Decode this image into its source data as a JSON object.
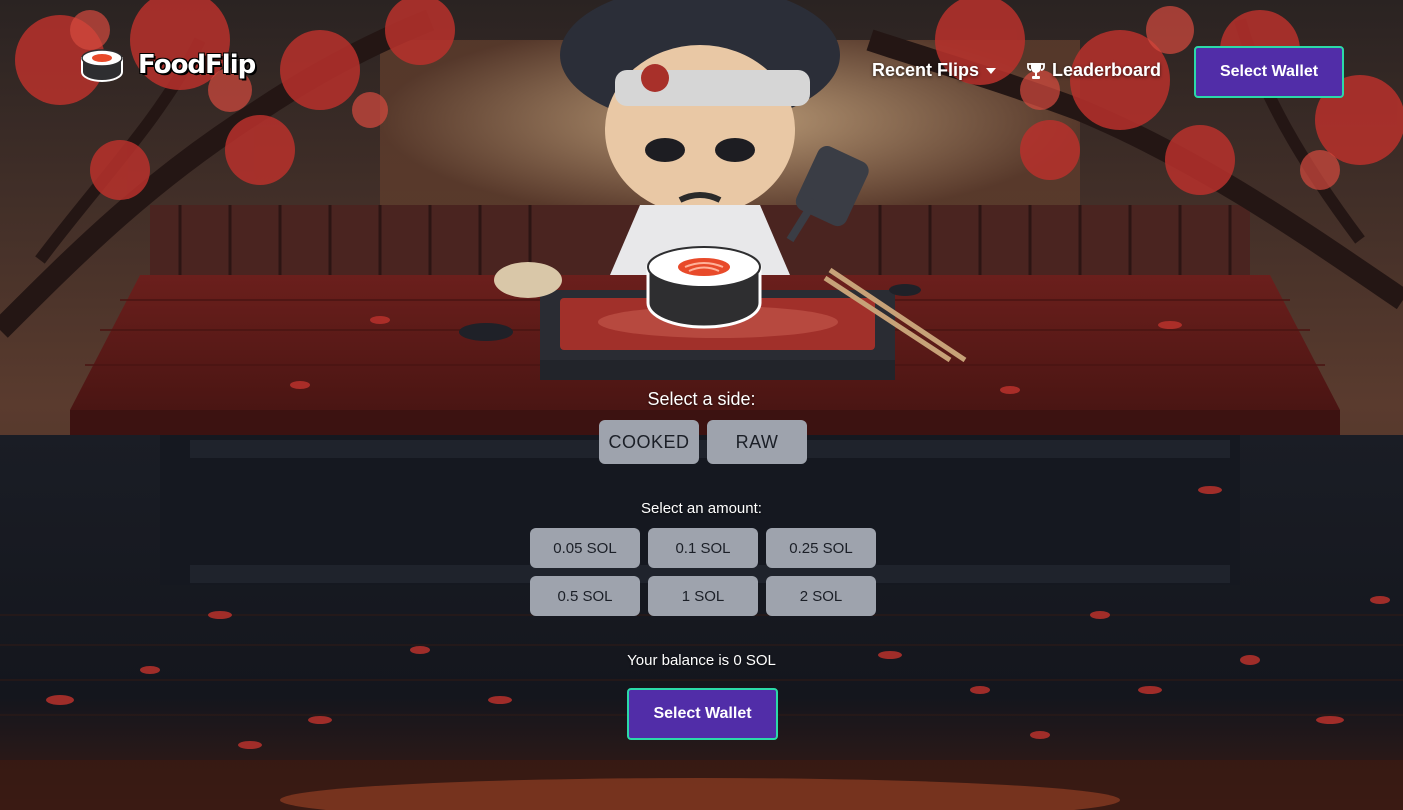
{
  "header": {
    "brand": "FoodFlip",
    "nav": {
      "recent_flips": "Recent Flips",
      "leaderboard": "Leaderboard",
      "select_wallet": "Select Wallet"
    }
  },
  "game": {
    "side_prompt": "Select a side:",
    "sides": [
      "COOKED",
      "RAW"
    ],
    "amount_prompt": "Select an amount:",
    "amounts": [
      "0.05 SOL",
      "0.1 SOL",
      "0.25 SOL",
      "0.5 SOL",
      "1 SOL",
      "2 SOL"
    ],
    "balance_text": "Your balance is 0 SOL",
    "wallet_button": "Select Wallet"
  },
  "colors": {
    "wallet_bg": "#512da8",
    "wallet_border": "#2bd9a9",
    "option_button": "#9ea3ad",
    "blossom": "#b8312c"
  }
}
